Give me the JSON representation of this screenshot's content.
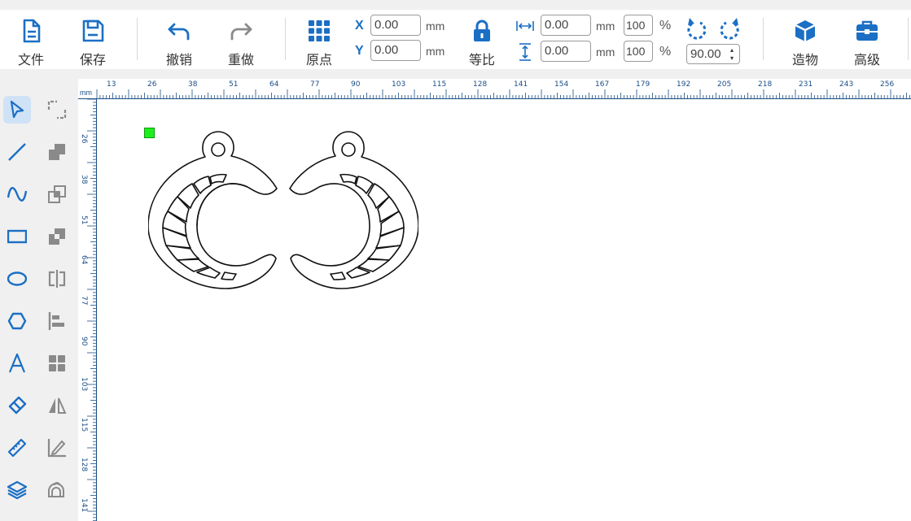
{
  "toolbar": {
    "file_label": "文件",
    "save_label": "保存",
    "undo_label": "撤销",
    "redo_label": "重做",
    "origin_label": "原点",
    "ratio_label": "等比",
    "build_label": "造物",
    "advanced_label": "高级",
    "x_axis_label": "X",
    "y_axis_label": "Y",
    "x_value": "0.00",
    "y_value": "0.00",
    "width_value": "0.00",
    "height_value": "0.00",
    "width_pct": "100",
    "height_pct": "100",
    "rotation_value": "90.00",
    "unit_mm": "mm",
    "pct_sign": "%"
  },
  "ruler": {
    "unit": "mm",
    "h_ticks": [
      "13",
      "26",
      "38",
      "51",
      "64",
      "77",
      "90",
      "103",
      "115",
      "128",
      "141",
      "154",
      "167",
      "179",
      "192",
      "205",
      "218",
      "231",
      "243",
      "256"
    ],
    "v_ticks": [
      "26",
      "38",
      "51",
      "64",
      "77",
      "90",
      "103",
      "115",
      "128",
      "141"
    ]
  },
  "tools": {
    "left_column": [
      "select-tool",
      "line-tool",
      "curve-tool",
      "rectangle-tool",
      "ellipse-tool",
      "polygon-tool",
      "text-tool",
      "eraser-tool",
      "ruler-tool",
      "layers-tool"
    ],
    "right_column": [
      "corner-tool",
      "union-tool",
      "intersect-tool",
      "subtract-tool",
      "split-tool",
      "align-tool",
      "grid-tool",
      "mirror-tool",
      "measure-tool",
      "offset-tool"
    ]
  },
  "colors": {
    "accent": "#1b6fc4",
    "active_tool_bg": "#cfe2f6",
    "marker": "#1cf01c",
    "disabled_icon": "#8a8a8a"
  }
}
